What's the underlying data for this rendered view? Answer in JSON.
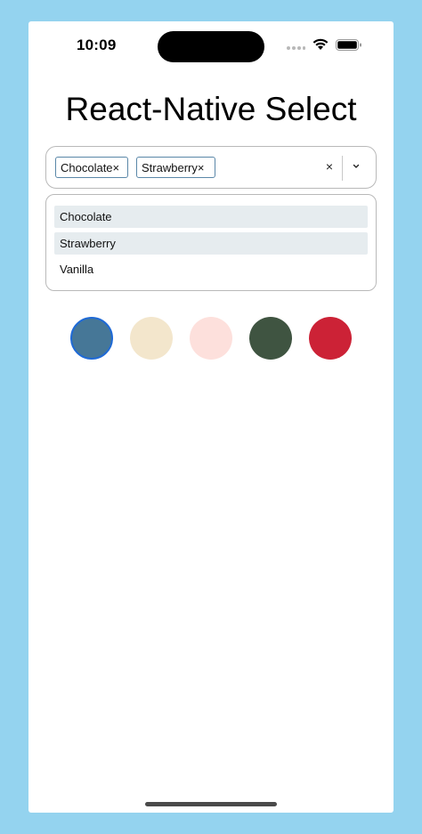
{
  "status_bar": {
    "time": "10:09"
  },
  "app": {
    "title": "React-Native Select"
  },
  "select": {
    "selected_chips": [
      {
        "label": "Chocolate",
        "remove": "×"
      },
      {
        "label": "Strawberry",
        "remove": "×"
      }
    ],
    "clear_icon": "×",
    "chevron_icon": "chevron-down-icon"
  },
  "dropdown": {
    "options": [
      {
        "label": "Chocolate",
        "selected": true
      },
      {
        "label": "Strawberry",
        "selected": true
      },
      {
        "label": "Vanilla",
        "selected": false
      }
    ]
  },
  "swatches": [
    {
      "color": "#467797",
      "selected": true
    },
    {
      "color": "#f3e6cc",
      "selected": false
    },
    {
      "color": "#fde0dc",
      "selected": false
    },
    {
      "color": "#3f5441",
      "selected": false
    },
    {
      "color": "#cc2236",
      "selected": false
    }
  ],
  "colors": {
    "background": "#94d3ef",
    "chip_border": "#5a87a8",
    "option_selected_bg": "#e6ecef",
    "swatch_selected_ring": "#1f6ad6"
  }
}
